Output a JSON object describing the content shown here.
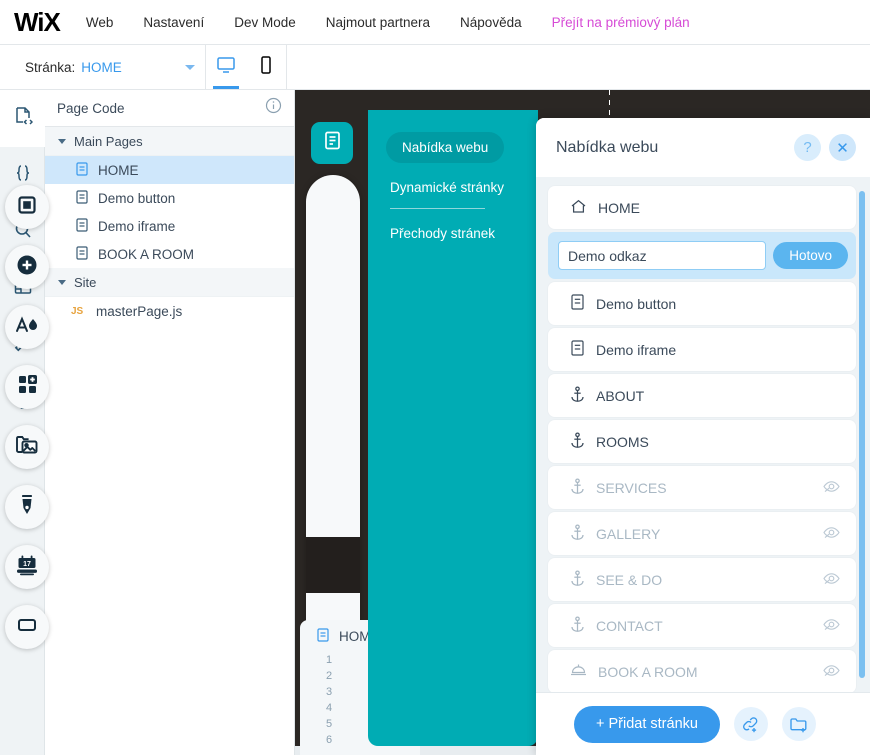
{
  "topbar": {
    "logo": "WiX",
    "items": [
      {
        "label": "Web",
        "premium": false
      },
      {
        "label": "Nastavení",
        "premium": false
      },
      {
        "label": "Dev Mode",
        "premium": false
      },
      {
        "label": "Najmout partnera",
        "premium": false
      },
      {
        "label": "Nápověda",
        "premium": false
      },
      {
        "label": "Přejít na prémiový plán",
        "premium": true
      }
    ],
    "premium_color": "#d64bd6"
  },
  "secondbar": {
    "page_label": "Stránka:",
    "page_value": "HOME",
    "device_desktop": "desktop-icon",
    "device_mobile": "mobile-icon",
    "active_device": "desktop",
    "active_color": "#3899ec"
  },
  "rail": {
    "items": [
      {
        "name": "page-code-icon",
        "active": true
      },
      {
        "name": "curly-braces-icon",
        "active": false
      },
      {
        "name": "search-icon",
        "active": false
      },
      {
        "name": "database-icon",
        "active": false
      },
      {
        "name": "wrench-icon",
        "active": false
      },
      {
        "name": "help-question-icon",
        "active": false
      }
    ]
  },
  "code_sidebar": {
    "title": "Page Code",
    "info_icon": "info-icon",
    "groups": [
      {
        "label": "Main Pages",
        "items": [
          {
            "label": "HOME",
            "icon": "page-icon",
            "selected": true
          },
          {
            "label": "Demo button",
            "icon": "page-icon",
            "selected": false
          },
          {
            "label": "Demo iframe",
            "icon": "page-icon",
            "selected": false
          },
          {
            "label": "BOOK A ROOM",
            "icon": "page-icon",
            "selected": false
          }
        ]
      },
      {
        "label": "Site",
        "items": [
          {
            "label": "masterPage.js",
            "icon": "js-icon",
            "selected": false
          }
        ]
      }
    ]
  },
  "toolbar": {
    "pages_icon": "pages-icon",
    "buttons": [
      {
        "name": "section-icon"
      },
      {
        "name": "add-plus-icon"
      },
      {
        "name": "theme-text-color-icon"
      },
      {
        "name": "add-apps-icon"
      },
      {
        "name": "my-uploads-media-icon"
      },
      {
        "name": "blog-pen-icon"
      },
      {
        "name": "bookings-calendar-icon"
      },
      {
        "name": "more-tools-icon"
      }
    ]
  },
  "teal_panel": {
    "background": "#00acb4",
    "tabs": [
      {
        "label": "Nabídka webu",
        "active": true
      },
      {
        "label": "Dynamické stránky",
        "active": false
      },
      {
        "label": "Přechody stránek",
        "active": false
      }
    ]
  },
  "menu_panel": {
    "title": "Nabídka webu",
    "help_icon": "question-mark-icon",
    "close_icon": "close-x-icon",
    "editing_value": "Demo odkaz",
    "editing_placeholder": "Demo odkaz",
    "done_label": "Hotovo",
    "items": [
      {
        "label": "HOME",
        "icon": "home-icon",
        "hidden": false,
        "editing": false
      },
      {
        "label": "Demo odkaz",
        "icon": "link-icon",
        "hidden": false,
        "editing": true
      },
      {
        "label": "Demo button",
        "icon": "page-icon",
        "hidden": false,
        "editing": false
      },
      {
        "label": "Demo iframe",
        "icon": "page-icon",
        "hidden": false,
        "editing": false
      },
      {
        "label": "ABOUT",
        "icon": "anchor-icon",
        "hidden": false,
        "editing": false
      },
      {
        "label": "ROOMS",
        "icon": "anchor-icon",
        "hidden": false,
        "editing": false
      },
      {
        "label": "SERVICES",
        "icon": "anchor-icon",
        "hidden": true,
        "editing": false
      },
      {
        "label": "GALLERY",
        "icon": "anchor-icon",
        "hidden": true,
        "editing": false
      },
      {
        "label": "SEE & DO",
        "icon": "anchor-icon",
        "hidden": true,
        "editing": false
      },
      {
        "label": "CONTACT",
        "icon": "anchor-icon",
        "hidden": true,
        "editing": false
      },
      {
        "label": "BOOK A ROOM",
        "icon": "bell-icon",
        "hidden": true,
        "editing": false
      }
    ],
    "footer": {
      "add_label": "+ Přidat stránku",
      "link_icon": "add-link-icon",
      "folder_icon": "add-folder-icon"
    }
  },
  "code_editor": {
    "tab_label": "HOME",
    "tab_icon": "page-icon",
    "line_numbers": [
      "1",
      "2",
      "3",
      "4",
      "5",
      "6"
    ]
  }
}
